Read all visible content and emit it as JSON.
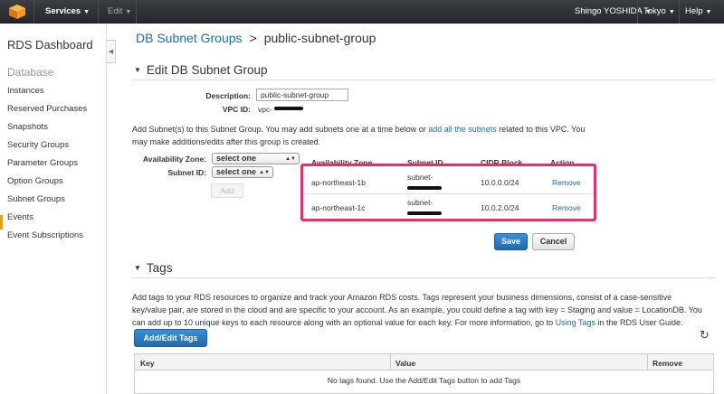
{
  "topnav": {
    "services": "Services",
    "edit": "Edit",
    "user": "Shingo YOSHIDA",
    "region": "Tokyo",
    "help": "Help"
  },
  "sidebar": {
    "title": "RDS Dashboard",
    "section": "Database",
    "items": [
      {
        "label": "Instances"
      },
      {
        "label": "Reserved Purchases"
      },
      {
        "label": "Snapshots"
      },
      {
        "label": "Security Groups"
      },
      {
        "label": "Parameter Groups"
      },
      {
        "label": "Option Groups"
      },
      {
        "label": "Subnet Groups"
      },
      {
        "label": "Events"
      },
      {
        "label": "Event Subscriptions"
      }
    ],
    "active_color": "#e4a016"
  },
  "breadcrumb": {
    "parent": "DB Subnet Groups",
    "separator": ">",
    "current": "public-subnet-group"
  },
  "edit_section": {
    "title": "Edit DB Subnet Group",
    "description_label": "Description:",
    "description_value": "public-subnet-group",
    "vpc_label": "VPC ID:",
    "vpc_prefix": "vpc-",
    "help_text_1": "Add Subnet(s) to this Subnet Group. You may add subnets one at a time below or",
    "help_link": "add all the subnets",
    "help_text_2": "related to this VPC. You",
    "help_text_3": "may make additions/edits after this group is created.",
    "az_label": "Availability Zone:",
    "az_value": "select one",
    "subnet_label": "Subnet ID:",
    "subnet_value": "select one",
    "add_button": "Add",
    "table": {
      "headers": [
        "Availability Zone",
        "Subnet ID",
        "CIDR Block",
        "Action"
      ],
      "rows": [
        {
          "az": "ap-northeast-1b",
          "subnet": "subnet-",
          "cidr": "10.0.0.0/24",
          "action": "Remove"
        },
        {
          "az": "ap-northeast-1c",
          "subnet": "subnet-",
          "cidr": "10.0.2.0/24",
          "action": "Remove"
        }
      ]
    },
    "highlight_color": "#e5306c",
    "save_button": "Save",
    "cancel_button": "Cancel"
  },
  "tags_section": {
    "title": "Tags",
    "text_1": "Add tags to your RDS resources to organize and track your Amazon RDS costs. Tags represent your business dimensions, consist of a case-sensitive",
    "text_2": "key/value pair, are stored in the cloud and are specific to your account. As an example, you could define a tag with key = Staging and value = LocationDB. You",
    "text_3": "can add up to 10 unique keys to each resource along with an optional value for each key. For more information, go to",
    "text_link": "Using Tags",
    "text_4": "in the RDS User Guide.",
    "add_edit_button": "Add/Edit Tags",
    "table_headers": [
      "Key",
      "Value",
      "Remove"
    ],
    "empty_message": "No tags found. Use the Add/Edit Tags button to add Tags"
  },
  "icons": {
    "refresh": "refresh-icon",
    "collapse": "collapse-sidebar-icon"
  }
}
